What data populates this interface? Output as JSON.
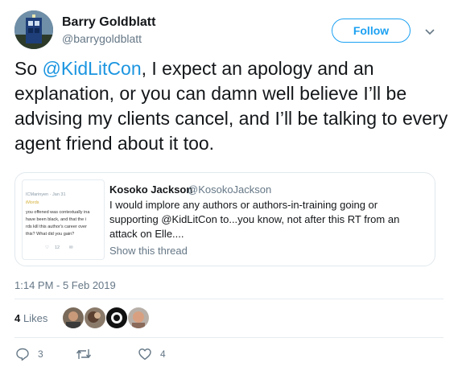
{
  "author": {
    "name": "Barry Goldblatt",
    "handle": "@barrygoldblatt"
  },
  "follow_label": "Follow",
  "tweet": {
    "prefix": "So ",
    "mention": "@KidLitCon",
    "rest": ", I expect an apology and an explanation, or you can damn well believe I’ll be advising my clients cancel, and I’ll be talking to every agent friend about it too."
  },
  "quote": {
    "name": "Kosoko Jackson",
    "handle": "@KosokoJackson",
    "text": "I would implore any authors or authors-in-training going or supporting @KidLitCon to...you know, not after this RT from an attack on Elle....",
    "show_thread": "Show this thread",
    "thumb_lines": [
      "ICMarinyen · Jan 31",
      "iMords",
      "you offened was contextually ina",
      "have been black, and that the i",
      "rds kill this author's career over",
      "this? What did you gain?"
    ],
    "thumb_like_count": "12"
  },
  "timestamp": "1:14 PM - 5 Feb 2019",
  "likes": {
    "count": "4",
    "label": "Likes"
  },
  "actions": {
    "reply_count": "3",
    "retweet_count": "",
    "like_count": "4"
  },
  "colors": {
    "accent": "#1da1f2",
    "link": "#1b95e0",
    "muted": "#657786"
  }
}
